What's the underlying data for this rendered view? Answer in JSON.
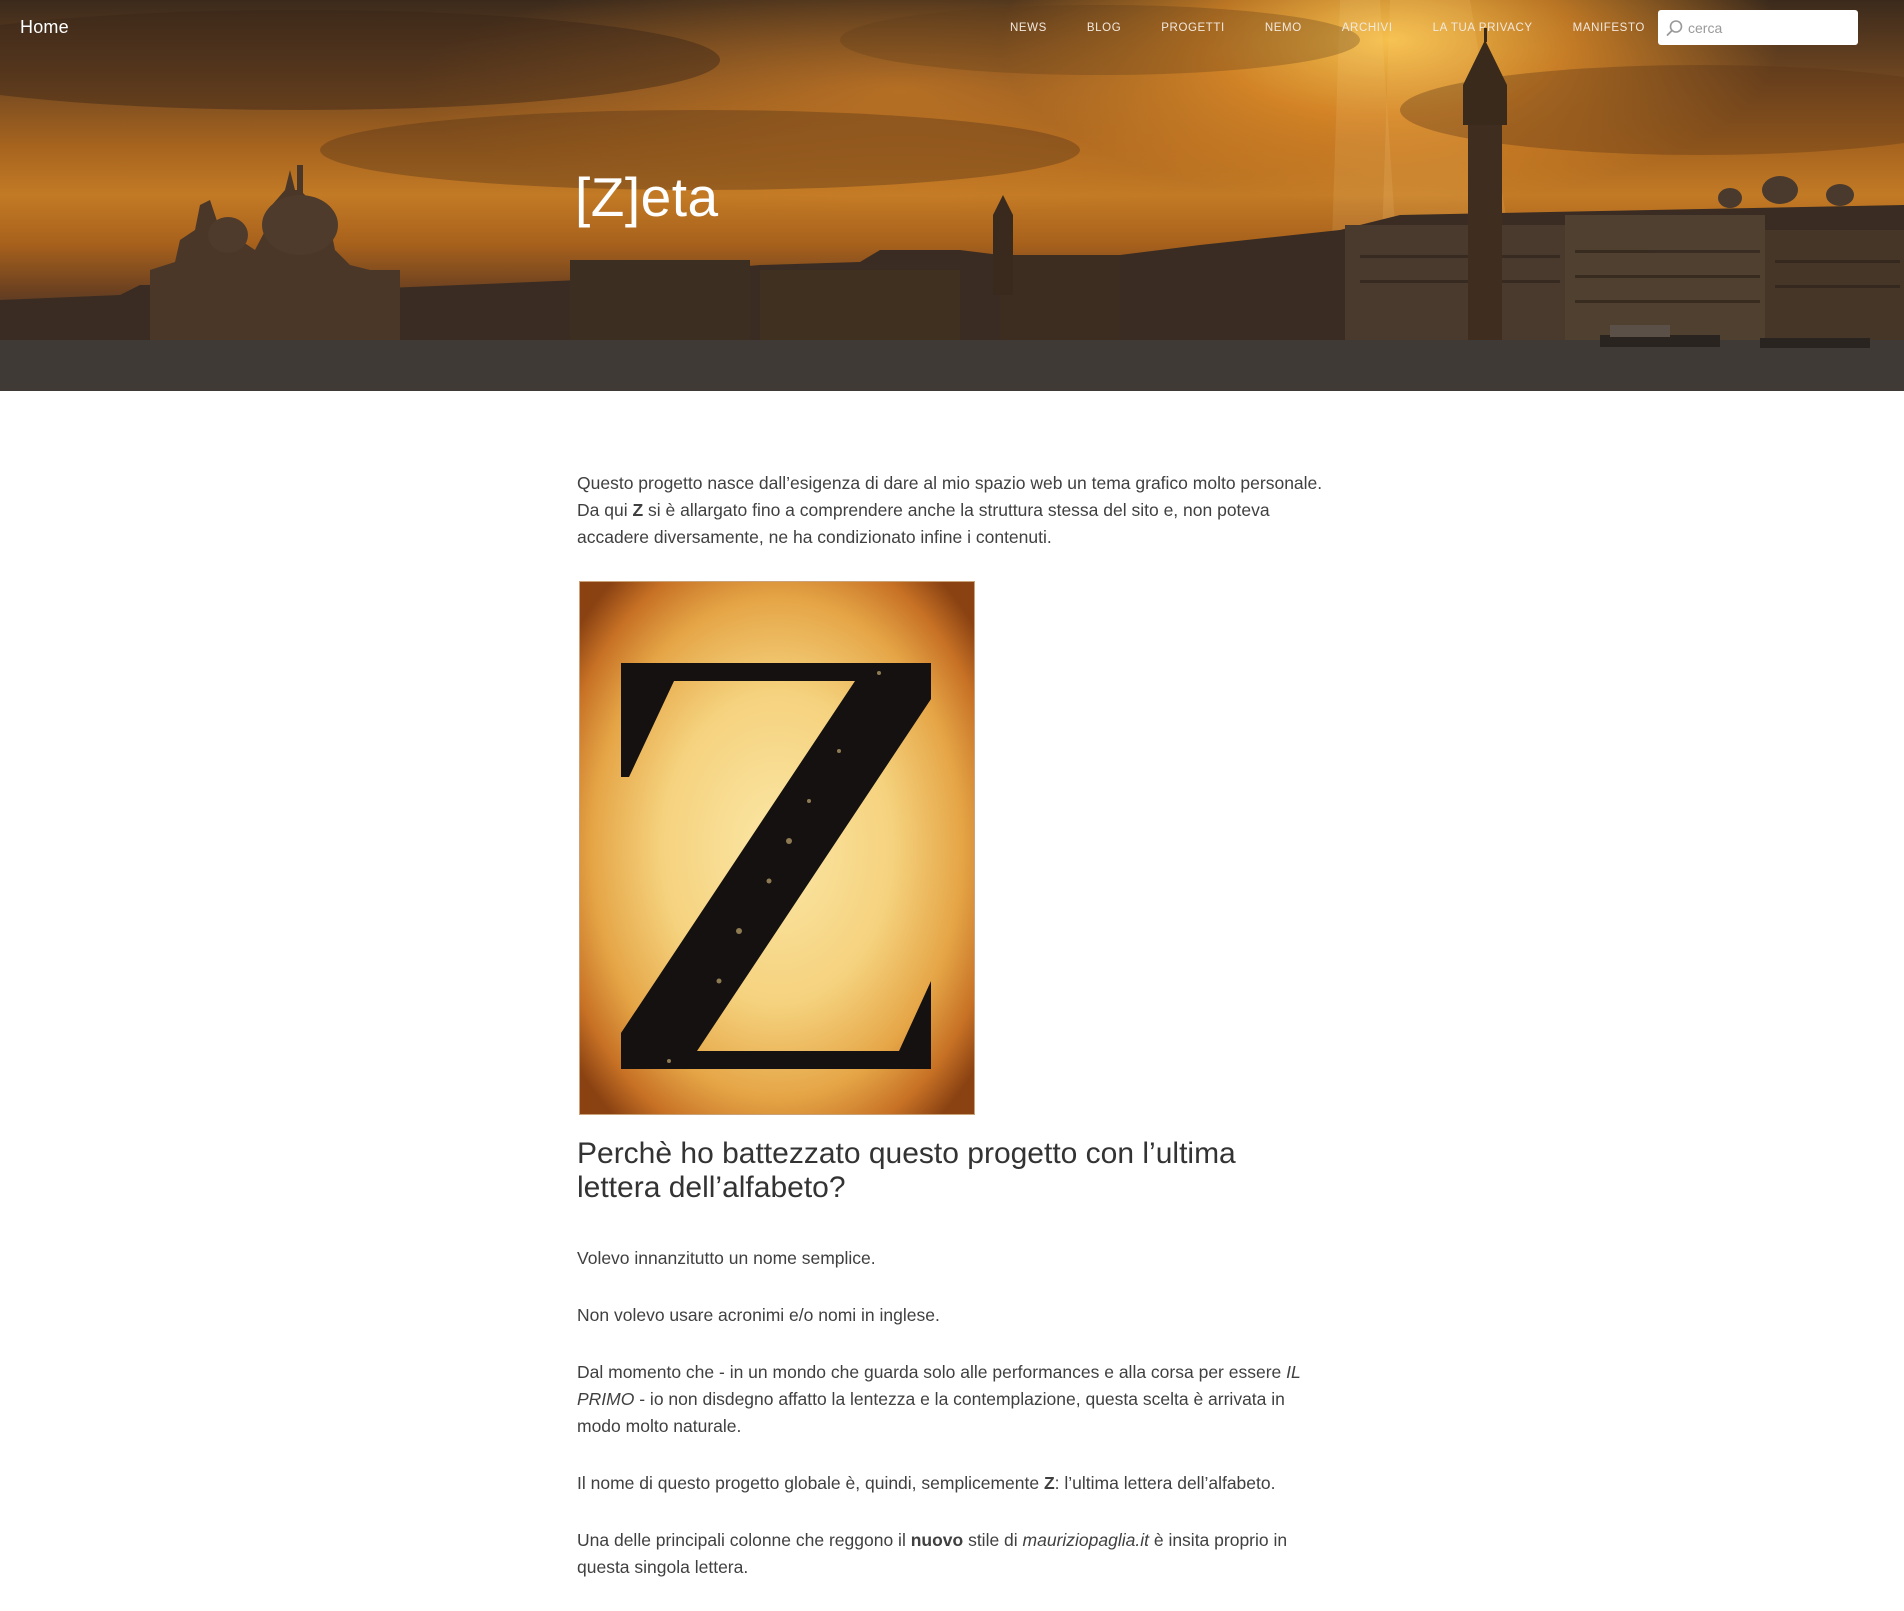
{
  "header": {
    "brand": "Home",
    "nav": [
      "News",
      "Blog",
      "Progetti",
      "Nemo",
      "Archivi",
      "La tua privacy",
      "Manifesto"
    ],
    "search_placeholder": "cerca",
    "search_icon": "search-icon"
  },
  "hero": {
    "title": "[Z]eta"
  },
  "article": {
    "intro_pre": "Questo progetto nasce dall’esigenza di dare al mio spazio web un tema grafico molto personale. Da qui ",
    "intro_strong": "Z",
    "intro_post": " si è allargato fino a comprendere anche la struttura stessa del sito e, non poteva accadere diversamente, ne ha condizionato infine i contenuti.",
    "image_letter": "Z",
    "heading": "Perchè ho battezzato questo progetto con l’ultima lettera dell’alfabeto?",
    "p1": "Volevo innanzitutto un nome semplice.",
    "p2": "Non volevo usare acronimi e/o nomi in inglese.",
    "p3_pre": "Dal momento che - in un mondo che guarda solo alle performances e alla corsa per essere ",
    "p3_em": "IL PRIMO",
    "p3_post": " - io non disdegno affatto la lentezza e la contemplazione, questa scelta è arrivata in modo molto naturale.",
    "p4_pre": "Il nome di questo progetto globale è, quindi, semplicemente ",
    "p4_strong": "Z",
    "p4_post": ": l’ultima lettera dell’alfabeto.",
    "p5_pre": "Una delle principali colonne che reggono il ",
    "p5_strong": "nuovo",
    "p5_mid": " stile di ",
    "p5_em": "mauriziopaglia.it",
    "p5_post": " è insita proprio in questa singola lettera."
  },
  "colors": {
    "hero_sun": "#f0a030",
    "text": "#404040",
    "heading": "#333333"
  }
}
